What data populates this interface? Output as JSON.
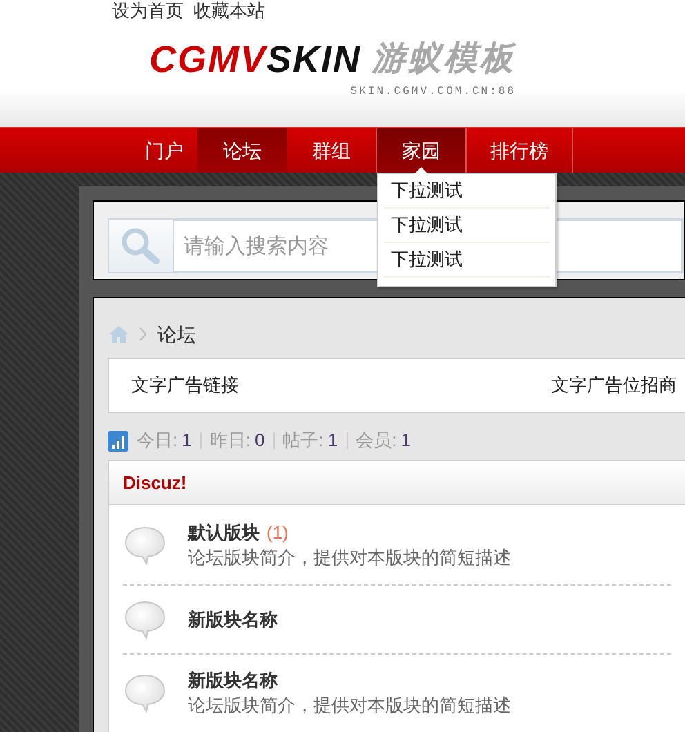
{
  "top_links": [
    "设为首页",
    "收藏本站"
  ],
  "logo": {
    "brand_red": "CGMV",
    "brand_dark": "SKIN",
    "brand_cn": "游蚁模板",
    "url": "SKIN.CGMV.COM.CN:88"
  },
  "nav": [
    {
      "label": "门户",
      "selected": false,
      "open": false
    },
    {
      "label": "论坛",
      "selected": true,
      "open": false
    },
    {
      "label": "群组",
      "selected": false,
      "open": false
    },
    {
      "label": "家园",
      "selected": false,
      "open": true
    },
    {
      "label": "排行榜",
      "selected": false,
      "open": false
    }
  ],
  "dropdown": [
    "下拉测试",
    "下拉测试",
    "下拉测试"
  ],
  "search": {
    "placeholder": "请输入搜索内容"
  },
  "breadcrumb": [
    "论坛"
  ],
  "ads": [
    "文字广告链接",
    "文字广告位招商"
  ],
  "stats": [
    {
      "label": "今日:",
      "value": "1"
    },
    {
      "label": "昨日:",
      "value": "0"
    },
    {
      "label": "帖子:",
      "value": "1"
    },
    {
      "label": "会员:",
      "value": "1"
    }
  ],
  "category": {
    "title": "Discuz!",
    "forums": [
      {
        "name": "默认版块",
        "count": "(1)",
        "description": "论坛版块简介，提供对本版块的简短描述"
      },
      {
        "name": "新版块名称"
      },
      {
        "name": "新版块名称",
        "description": "论坛版块简介，提供对本版块的简短描述"
      }
    ]
  }
}
